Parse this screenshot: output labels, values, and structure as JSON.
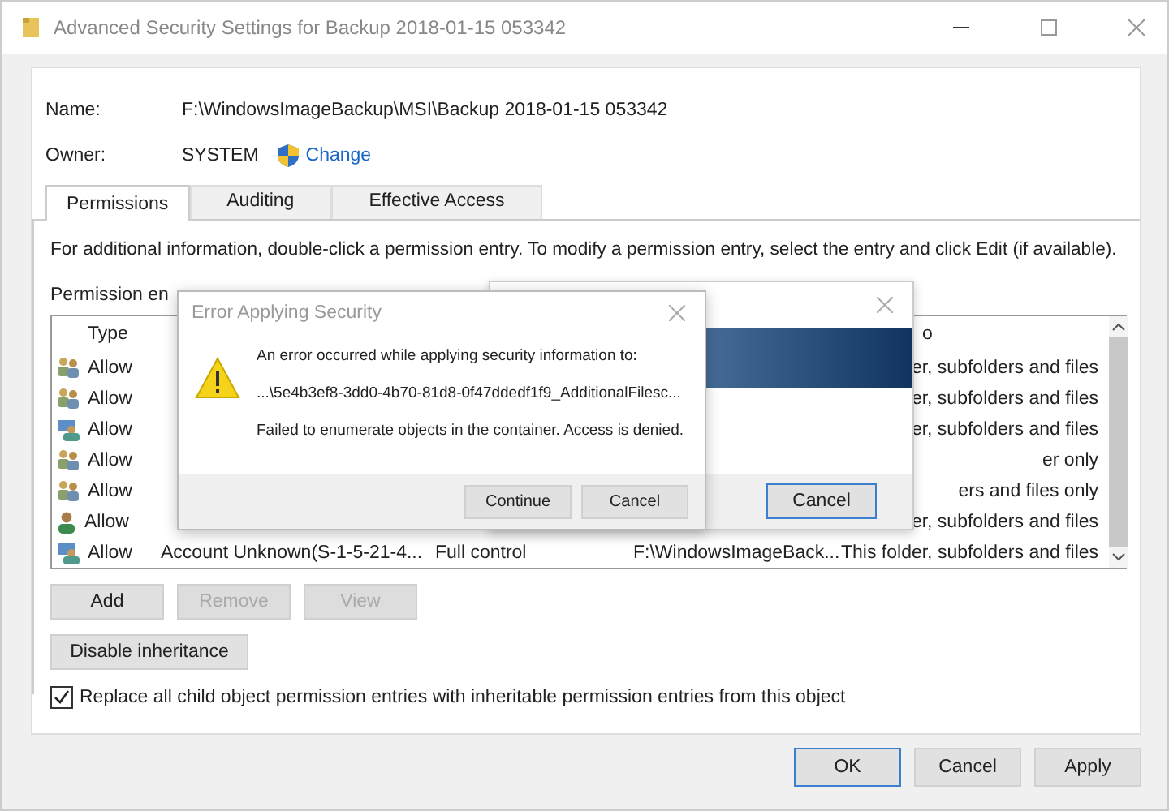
{
  "window": {
    "title": "Advanced Security Settings for Backup 2018-01-15 053342"
  },
  "name": {
    "label": "Name:",
    "value": "F:\\WindowsImageBackup\\MSI\\Backup 2018-01-15 053342"
  },
  "owner": {
    "label": "Owner:",
    "value": "SYSTEM",
    "link": "Change"
  },
  "tabs": [
    {
      "label": "Permissions",
      "selected": true
    },
    {
      "label": "Auditing",
      "selected": false
    },
    {
      "label": "Effective Access",
      "selected": false
    }
  ],
  "info": "For additional information, double-click a permission entry. To modify a permission entry, select the entry and click Edit (if available).",
  "entries_label": "Permission en",
  "table": {
    "columns": [
      "Type",
      "o"
    ],
    "rows": [
      {
        "kind": "group",
        "type": "Allow",
        "applies_to": "er, subfolders and files"
      },
      {
        "kind": "group",
        "type": "Allow",
        "applies_to": "er, subfolders and files"
      },
      {
        "kind": "special",
        "type": "Allow",
        "applies_to": "er, subfolders and files"
      },
      {
        "kind": "group",
        "type": "Allow",
        "applies_to": "er only"
      },
      {
        "kind": "group",
        "type": "Allow",
        "applies_to": "ers and files only"
      },
      {
        "kind": "user",
        "type": "Allow",
        "applies_to": "er, subfolders and files"
      },
      {
        "kind": "special",
        "type": "Allow",
        "principal": "Account Unknown(S-1-5-21-4...",
        "access": "Full control",
        "inherited_from": "F:\\WindowsImageBack...",
        "applies_to": "This folder, subfolders and files"
      }
    ]
  },
  "buttons": [
    {
      "label": "Add",
      "disabled": false
    },
    {
      "label": "Remove",
      "disabled": true
    },
    {
      "label": "View",
      "disabled": true
    }
  ],
  "inheritance_button": "Disable inheritance",
  "replace_checkbox": {
    "label": "Replace all child object permission entries with inheritable permission entries from this object",
    "checked": true
  },
  "footer_buttons": [
    {
      "label": "OK",
      "default": true
    },
    {
      "label": "Cancel",
      "default": false
    },
    {
      "label": "Apply",
      "default": false
    }
  ],
  "progress_dialog": {
    "button": "Cancel"
  },
  "error_dialog": {
    "title": "Error Applying Security",
    "message": "An error occurred while applying security information to:",
    "path": "...\\5e4b3ef8-3dd0-4b70-81d8-0f47ddedf1f9_AdditionalFilesc...",
    "detail": "Failed to enumerate objects in the container. Access is denied.",
    "buttons": [
      "Continue",
      "Cancel"
    ]
  }
}
